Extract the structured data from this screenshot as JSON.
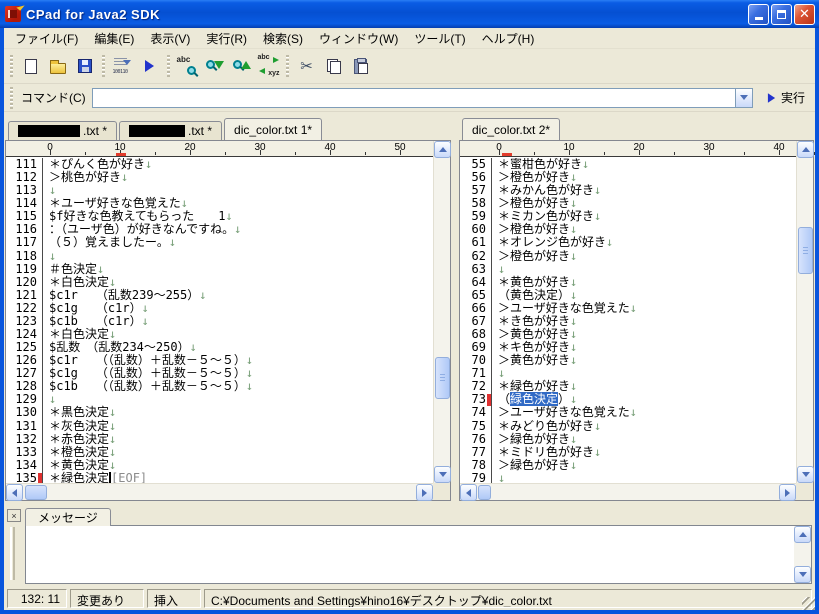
{
  "window": {
    "title": "CPad for Java2 SDK"
  },
  "menu_bar": {
    "items": [
      "ファイル(F)",
      "編集(E)",
      "表示(V)",
      "実行(R)",
      "検索(S)",
      "ウィンドウ(W)",
      "ツール(T)",
      "ヘルプ(H)"
    ]
  },
  "toolbar": {
    "goto_icon_text": "100110",
    "search_icon_text": "abc",
    "replace_icon_text_top": "abc",
    "replace_icon_text_bottom": "xyz",
    "cut_icon_glyph": "✂"
  },
  "command_bar": {
    "label": "コマンド(C)",
    "value": "",
    "run_label": "実行"
  },
  "colors": {
    "selection_bg": "#316AC5",
    "cursor_marker_red": "#E03030",
    "newline_mark": "#789F78",
    "eof_text": "#8C8C8C",
    "titlebar_blue": "#0550D2"
  },
  "editors": {
    "eof_label": "[EOF]",
    "newline_glyph": "↓",
    "left": {
      "tabs": [
        {
          "label": "",
          "redacted": true,
          "redact_w": 62,
          "suffix": ".txt *",
          "active": false
        },
        {
          "label": "",
          "redacted": true,
          "redact_w": 56,
          "suffix": ".txt *",
          "active": false
        },
        {
          "label": "dic_color.txt 1*",
          "redacted": false,
          "active": true
        }
      ],
      "ruler": {
        "ticks": [
          0,
          10,
          20,
          30,
          40,
          50
        ],
        "marker_col": 10
      },
      "lines": [
        {
          "no": 111,
          "segs": [
            {
              "t": "＊ぴんく色が好き"
            }
          ],
          "nl": true
        },
        {
          "no": 112,
          "segs": [
            {
              "t": "＞桃色が好き"
            }
          ],
          "nl": true
        },
        {
          "no": 113,
          "segs": [],
          "nl": true
        },
        {
          "no": 114,
          "segs": [
            {
              "t": "＊ユーザ好きな色覚えた"
            }
          ],
          "nl": true
        },
        {
          "no": 115,
          "segs": [
            {
              "t": "$f好きな色教えてもらった　　1"
            }
          ],
          "nl": true
        },
        {
          "no": 116,
          "segs": [
            {
              "t": "：（ユーザ色）が好きなんですね。"
            }
          ],
          "nl": true
        },
        {
          "no": 117,
          "segs": [
            {
              "t": "（５）覚えましたー。"
            }
          ],
          "nl": true
        },
        {
          "no": 118,
          "segs": [],
          "nl": true
        },
        {
          "no": 119,
          "segs": [
            {
              "t": "＃色決定"
            }
          ],
          "nl": true
        },
        {
          "no": 120,
          "segs": [
            {
              "t": "＊白色決定"
            }
          ],
          "nl": true
        },
        {
          "no": 121,
          "segs": [
            {
              "t": "$c1r　　（乱数239～255）"
            }
          ],
          "nl": true
        },
        {
          "no": 122,
          "segs": [
            {
              "t": "$c1g　　（c1r）"
            }
          ],
          "nl": true
        },
        {
          "no": 123,
          "segs": [
            {
              "t": "$c1b　　（c1r）"
            }
          ],
          "nl": true
        },
        {
          "no": 124,
          "segs": [
            {
              "t": "＊白色決定"
            }
          ],
          "nl": true
        },
        {
          "no": 125,
          "segs": [
            {
              "t": "$乱数　（乱数234～250）"
            }
          ],
          "nl": true
        },
        {
          "no": 126,
          "segs": [
            {
              "t": "$c1r　　（（乱数）＋乱数－５～５）"
            }
          ],
          "nl": true
        },
        {
          "no": 127,
          "segs": [
            {
              "t": "$c1g　　（（乱数）＋乱数－５～５）"
            }
          ],
          "nl": true
        },
        {
          "no": 128,
          "segs": [
            {
              "t": "$c1b　　（（乱数）＋乱数－５～５）"
            }
          ],
          "nl": true
        },
        {
          "no": 129,
          "segs": [],
          "nl": true
        },
        {
          "no": 130,
          "segs": [
            {
              "t": "＊黒色決定"
            }
          ],
          "nl": true
        },
        {
          "no": 131,
          "segs": [
            {
              "t": "＊灰色決定"
            }
          ],
          "nl": true
        },
        {
          "no": 132,
          "segs": [
            {
              "t": "＊赤色決定"
            }
          ],
          "nl": true
        },
        {
          "no": 133,
          "segs": [
            {
              "t": "＊橙色決定"
            }
          ],
          "nl": true
        },
        {
          "no": 134,
          "segs": [
            {
              "t": "＊黄色決定"
            }
          ],
          "nl": true
        },
        {
          "no": 135,
          "segs": [
            {
              "t": "＊緑色決定"
            }
          ],
          "nl": false,
          "mark": true,
          "caret": true,
          "eof": true
        }
      ]
    },
    "right": {
      "tabs": [
        {
          "label": "dic_color.txt 2*",
          "redacted": false,
          "active": true
        }
      ],
      "ruler": {
        "ticks": [
          0,
          10,
          20,
          30,
          40
        ],
        "marker_col": 1
      },
      "lines": [
        {
          "no": 55,
          "segs": [
            {
              "t": "＊蜜柑色が好き"
            }
          ],
          "nl": true
        },
        {
          "no": 56,
          "segs": [
            {
              "t": "＞橙色が好き"
            }
          ],
          "nl": true
        },
        {
          "no": 57,
          "segs": [
            {
              "t": "＊みかん色が好き"
            }
          ],
          "nl": true
        },
        {
          "no": 58,
          "segs": [
            {
              "t": "＞橙色が好き"
            }
          ],
          "nl": true
        },
        {
          "no": 59,
          "segs": [
            {
              "t": "＊ミカン色が好き"
            }
          ],
          "nl": true
        },
        {
          "no": 60,
          "segs": [
            {
              "t": "＞橙色が好き"
            }
          ],
          "nl": true
        },
        {
          "no": 61,
          "segs": [
            {
              "t": "＊オレンジ色が好き"
            }
          ],
          "nl": true
        },
        {
          "no": 62,
          "segs": [
            {
              "t": "＞橙色が好き"
            }
          ],
          "nl": true
        },
        {
          "no": 63,
          "segs": [],
          "nl": true
        },
        {
          "no": 64,
          "segs": [
            {
              "t": "＊黄色が好き"
            }
          ],
          "nl": true
        },
        {
          "no": 65,
          "segs": [
            {
              "t": "（黄色決定）"
            }
          ],
          "nl": true
        },
        {
          "no": 66,
          "segs": [
            {
              "t": "＞ユーザ好きな色覚えた"
            }
          ],
          "nl": true
        },
        {
          "no": 67,
          "segs": [
            {
              "t": "＊き色が好き"
            }
          ],
          "nl": true
        },
        {
          "no": 68,
          "segs": [
            {
              "t": "＞黄色が好き"
            }
          ],
          "nl": true
        },
        {
          "no": 69,
          "segs": [
            {
              "t": "＊キ色が好き"
            }
          ],
          "nl": true
        },
        {
          "no": 70,
          "segs": [
            {
              "t": "＞黄色が好き"
            }
          ],
          "nl": true
        },
        {
          "no": 71,
          "segs": [],
          "nl": true
        },
        {
          "no": 72,
          "segs": [
            {
              "t": "＊緑色が好き"
            }
          ],
          "nl": true
        },
        {
          "no": 73,
          "segs": [
            {
              "t": "（"
            },
            {
              "t": "緑色決定",
              "sel": true
            },
            {
              "t": "）"
            }
          ],
          "nl": true,
          "mark": true
        },
        {
          "no": 74,
          "segs": [
            {
              "t": "＞ユーザ好きな色覚えた"
            }
          ],
          "nl": true
        },
        {
          "no": 75,
          "segs": [
            {
              "t": "＊みどり色が好き"
            }
          ],
          "nl": true
        },
        {
          "no": 76,
          "segs": [
            {
              "t": "＞緑色が好き"
            }
          ],
          "nl": true
        },
        {
          "no": 77,
          "segs": [
            {
              "t": "＊ミドリ色が好き"
            }
          ],
          "nl": true
        },
        {
          "no": 78,
          "segs": [
            {
              "t": "＞緑色が好き"
            }
          ],
          "nl": true
        },
        {
          "no": 79,
          "segs": [],
          "nl": true
        }
      ]
    }
  },
  "message_panel": {
    "tab_label": "メッセージ",
    "content": "",
    "close_glyph": "×"
  },
  "status_bar": {
    "cursor_position": "132: 11",
    "modified": "変更あり",
    "input_mode": "挿入",
    "file_path": "C:¥Documents and Settings¥hino16¥デスクトップ¥dic_color.txt"
  }
}
